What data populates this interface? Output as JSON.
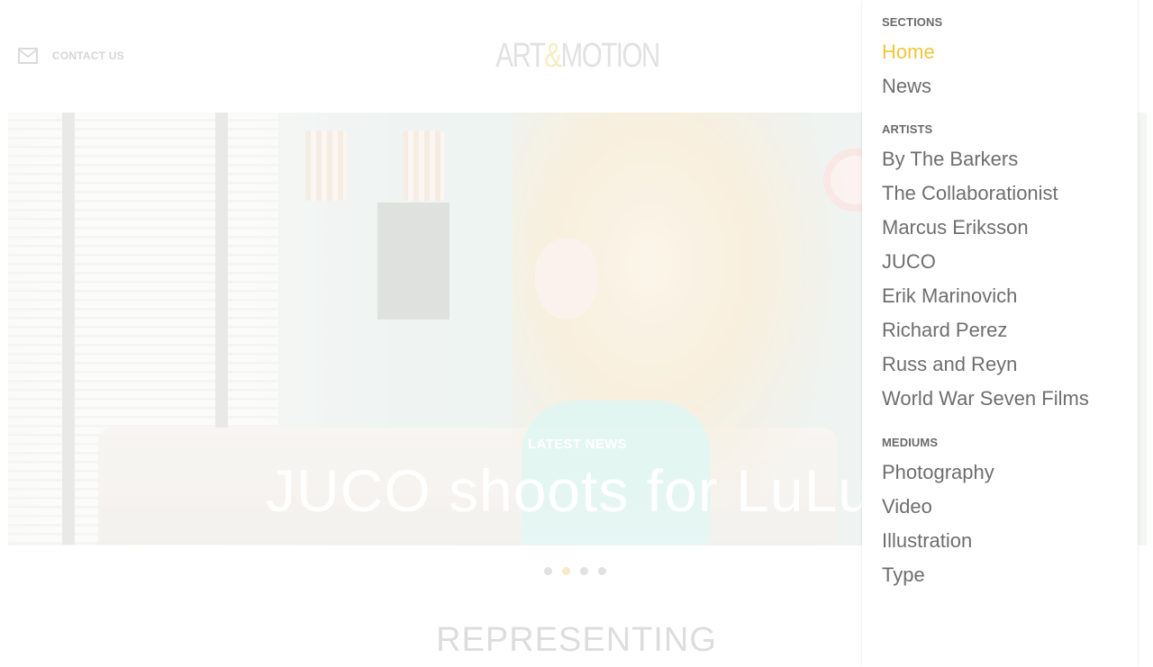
{
  "header": {
    "contact_label": "CONTACT US",
    "logo_left": "ART",
    "logo_amp": "&",
    "logo_right": "MOTION"
  },
  "hero": {
    "eyebrow": "LATEST NEWS",
    "title": "JUCO shoots for LuLu'"
  },
  "slider": {
    "count": 4,
    "active_index": 1
  },
  "section_title": "REPRESENTING",
  "menu": {
    "sections_heading": "SECTIONS",
    "sections": [
      "Home",
      "News"
    ],
    "active_section": "Home",
    "artists_heading": "ARTISTS",
    "artists": [
      "By The Barkers",
      "The Collaborationist",
      "Marcus Eriksson",
      "JUCO",
      "Erik Marinovich",
      "Richard Perez",
      "Russ and Reyn",
      "World War Seven Films"
    ],
    "mediums_heading": "MEDIUMS",
    "mediums": [
      "Photography",
      "Video",
      "Illustration",
      "Type"
    ]
  },
  "colors": {
    "accent": "#f0c63c",
    "menu_text": "#6e6e6e",
    "heading_text": "#6b6b6b"
  },
  "icons": {
    "contact": "mail-icon"
  }
}
